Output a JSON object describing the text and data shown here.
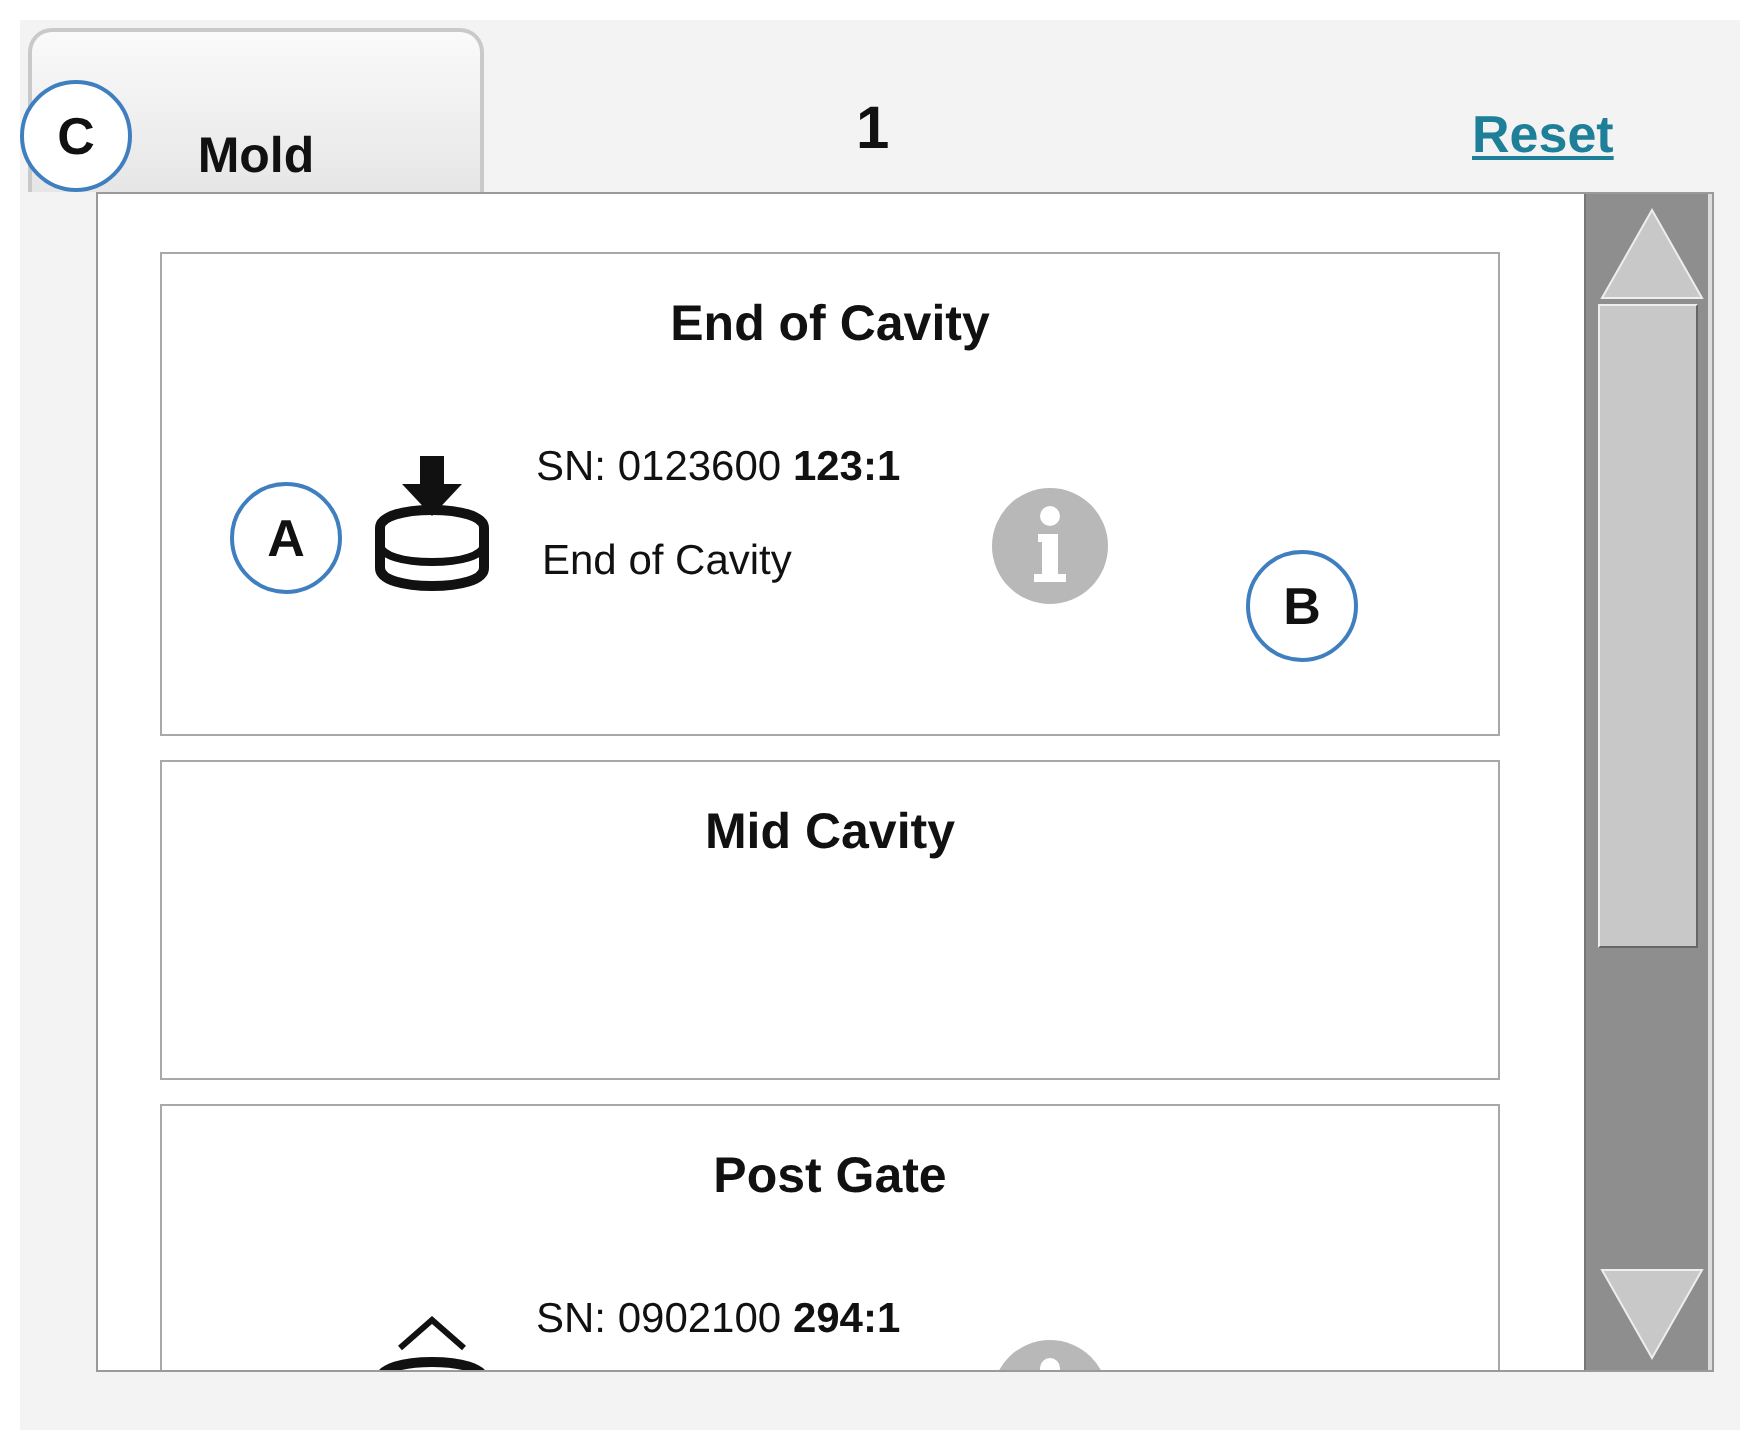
{
  "tab": {
    "label": "Mold",
    "callout": "C"
  },
  "count": "1",
  "reset_link": "Reset",
  "sensors": [
    {
      "title": "End of Cavity",
      "kind": "cavity",
      "serial": "SN: 0123600 **123:1**",
      "location": "End of Cavity",
      "icon_callout": "A",
      "info_callout": "B"
    },
    {
      "title": "Mid Cavity",
      "kind": "empty"
    },
    {
      "title": "Post Gate",
      "kind": "gate",
      "serial": "SN: 0902100 **294:1**"
    }
  ]
}
